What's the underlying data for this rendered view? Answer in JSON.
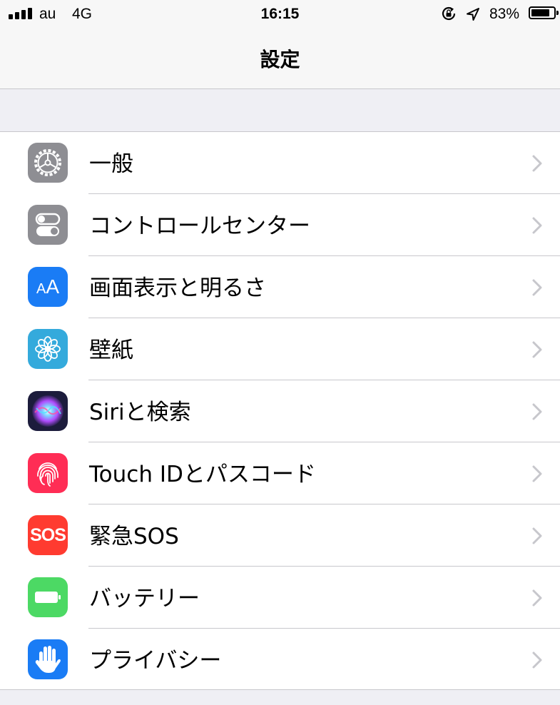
{
  "status_bar": {
    "carrier": "au",
    "network": "4G",
    "time": "16:15",
    "battery_percent": "83%",
    "battery_level": 0.83,
    "icons": [
      "signal-bars-icon",
      "rotation-lock-icon",
      "location-arrow-icon",
      "battery-icon"
    ]
  },
  "nav": {
    "title": "設定"
  },
  "settings": {
    "items": [
      {
        "label": "一般",
        "icon": "gear-icon",
        "color": "#8e8e93"
      },
      {
        "label": "コントロールセンター",
        "icon": "toggles-icon",
        "color": "#8e8e93"
      },
      {
        "label": "画面表示と明るさ",
        "icon": "text-size-icon",
        "icon_text": "AA",
        "color": "#1a7cf5"
      },
      {
        "label": "壁紙",
        "icon": "flower-icon",
        "color": "#34aadc"
      },
      {
        "label": "Siriと検索",
        "icon": "siri-icon",
        "color": "#1c1c3c"
      },
      {
        "label": "Touch IDとパスコード",
        "icon": "fingerprint-icon",
        "color": "#ff2d55"
      },
      {
        "label": "緊急SOS",
        "icon": "sos-icon",
        "icon_text": "SOS",
        "color": "#ff3b30"
      },
      {
        "label": "バッテリー",
        "icon": "battery-icon",
        "color": "#4cd964"
      },
      {
        "label": "プライバシー",
        "icon": "hand-icon",
        "color": "#1a7cf5"
      }
    ]
  }
}
